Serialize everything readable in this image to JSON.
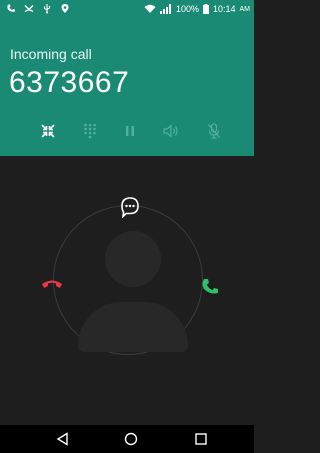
{
  "status_bar": {
    "battery": "100%",
    "time": "10:14",
    "ampm": "AM",
    "left_icons": [
      "phone-icon",
      "missed-call-icon",
      "usb-icon",
      "location-icon"
    ],
    "right_icons": [
      "wifi-icon",
      "signal-icon",
      "battery-icon"
    ]
  },
  "call": {
    "status_label": "Incoming call",
    "number": "6373667"
  },
  "controls": [
    {
      "name": "collapse-button",
      "icon": "collapse-icon",
      "enabled": true
    },
    {
      "name": "dialpad-button",
      "icon": "dialpad-icon",
      "enabled": false
    },
    {
      "name": "hold-button",
      "icon": "pause-icon",
      "enabled": false
    },
    {
      "name": "speaker-button",
      "icon": "speaker-icon",
      "enabled": false
    },
    {
      "name": "mute-button",
      "icon": "mic-off-icon",
      "enabled": false
    }
  ],
  "actions": {
    "message_icon": "message-icon",
    "decline_icon": "decline-phone-icon",
    "answer_icon": "answer-phone-icon",
    "decline_color": "#e53846",
    "answer_color": "#2fbf6a"
  },
  "navigation": [
    "back-icon",
    "home-icon",
    "recents-icon"
  ],
  "colors": {
    "header": "#1a8a75",
    "background": "#1e1e1e"
  }
}
